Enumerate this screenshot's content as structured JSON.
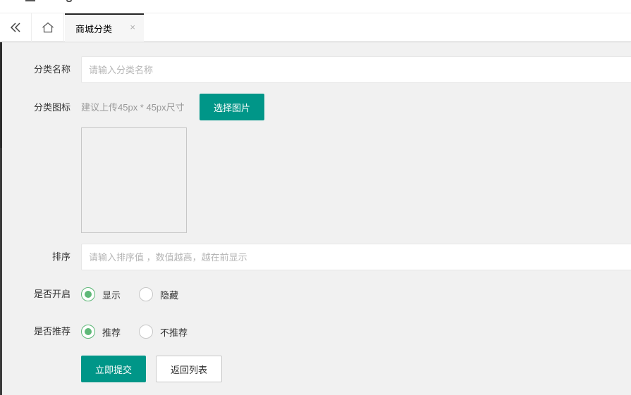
{
  "tabs": {
    "back_icon": "double-chevron-left-icon",
    "home_icon": "home-icon",
    "active_label": "商城分类",
    "close_glyph": "×"
  },
  "form": {
    "name": {
      "label": "分类名称",
      "value": "",
      "placeholder": "请输入分类名称"
    },
    "icon": {
      "label": "分类图标",
      "hint": "建议上传45px * 45px尺寸",
      "button": "选择图片"
    },
    "sort": {
      "label": "排序",
      "value": "",
      "placeholder": "请输入排序值 ，数值越高，越在前显示"
    },
    "enabled": {
      "label": "是否开启",
      "options": [
        {
          "label": "显示",
          "checked": true
        },
        {
          "label": "隐藏",
          "checked": false
        }
      ]
    },
    "recommend": {
      "label": "是否推荐",
      "options": [
        {
          "label": "推荐",
          "checked": true
        },
        {
          "label": "不推荐",
          "checked": false
        }
      ]
    },
    "submit_label": "立即提交",
    "back_label": "返回列表"
  },
  "colors": {
    "primary": "#009688",
    "radio_checked": "#5fb878",
    "background": "#f1f1f1"
  }
}
